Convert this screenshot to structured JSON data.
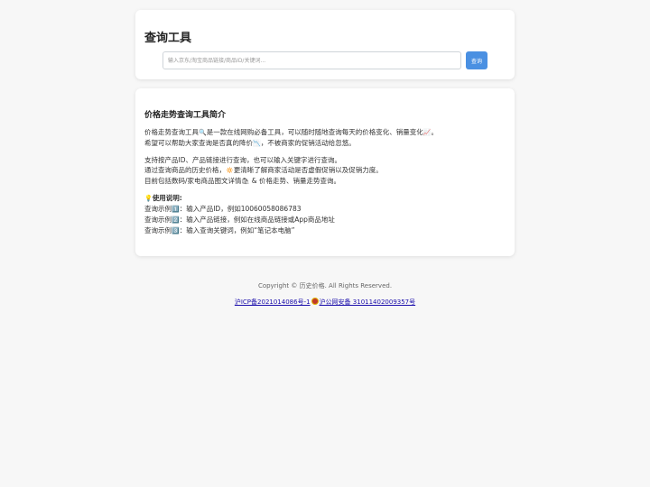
{
  "header": {
    "title": "查询工具"
  },
  "search": {
    "placeholder": "输入京东/淘宝商品链接/商品ID/关键词...",
    "value": "",
    "button_label": "查询"
  },
  "intro": {
    "title": "价格走势查询工具简介",
    "p1_l1_a": "价格走势查询工具",
    "p1_l1_icon": "🔍",
    "p1_l1_b": "是一款在线网购必备工具，可以随时随地查询每天的价格变化、销量变化",
    "p1_l1_icon2": "📈",
    "p1_l1_c": "。",
    "p1_l2_a": "希望可以帮助大家查询是否真的降价",
    "p1_l2_icon": "📉",
    "p1_l2_b": "，不被商家的促销活动给忽悠。",
    "p2_l1": "支持按产品ID、产品链接进行查询，也可以输入关键字进行查询。",
    "p2_l2_a": "通过查询商品的历史价格，",
    "p2_l2_icon": "🔅",
    "p2_l2_b": "更清晰了解商家活动是否虚假促销以及促销力度。",
    "p2_l3_a": "目前包括数码/家电商品图文详情",
    "p2_l3_icon": "🛍",
    "p2_l3_b": " & 价格走势、销量走势查询。",
    "usage_icon": "💡",
    "usage_title": "使用说明:",
    "examples": [
      {
        "prefix": "查询示例",
        "num": "1️⃣",
        "text": "：输入产品ID，例如10060058086783"
      },
      {
        "prefix": "查询示例",
        "num": "2️⃣",
        "text": "：输入产品链接，例如在线商品链接或App商品地址"
      },
      {
        "prefix": "查询示例",
        "num": "3️⃣",
        "text": "：输入查询关键词，例如“笔记本电脑”"
      }
    ]
  },
  "footer": {
    "copyright": "Copyright © 历史价格. All Rights Reserved.",
    "icp": "沪ICP备2021014086号-1",
    "police": "沪公网安备 31011402009357号"
  },
  "colors": {
    "accent": "#4a90e2",
    "background": "#f7f7f7",
    "link": "#1a0dab"
  }
}
